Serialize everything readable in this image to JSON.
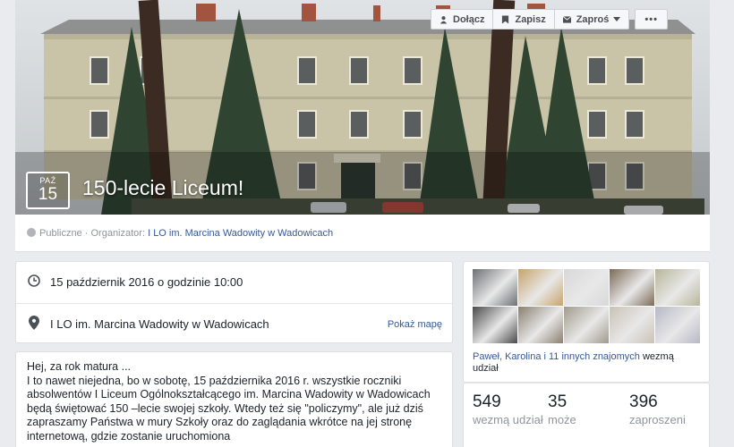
{
  "event": {
    "month": "PAŹ",
    "day": "15",
    "title": "150-lecie Liceum!"
  },
  "infobar": {
    "privacy": "Publiczne",
    "organizer_prefix": "· Organizator:",
    "organizer_name": "I LO im. Marcina Wadowity w Wadowicach"
  },
  "actions": {
    "join": "Dołącz",
    "save": "Zapisz",
    "invite": "Zaproś",
    "more": "•••"
  },
  "details": {
    "datetime": "15 październik 2016 o godzinie 10:00",
    "location": "I LO im. Marcina Wadowity w Wadowicach",
    "map_link": "Pokaż mapę"
  },
  "description": {
    "line1": "Hej, za rok matura ...",
    "body": "I to nawet niejedna, bo w sobotę, 15 października 2016 r. wszystkie roczniki absolwentów I Liceum Ogólnokształcącego im. Marcina Wadowity w Wadowicach będą świętować 150 –lecie swojej szkoły. Wtedy też się \"policzymy\", ale już dziś zapraszamy Państwa w mury Szkoły oraz do zaglądania wkrótce na jej stronę internetową, gdzie zostanie uruchomiona"
  },
  "friends": {
    "names": "Paweł, Karolina i 11 innych znajomych",
    "suffix": "wezmą udział",
    "avatar_colors": [
      "#6d6f73",
      "#c8a36a",
      "#d8d8d8",
      "#7c6a57",
      "#b8b59a",
      "#4a4a4a",
      "#8a7f6f",
      "#a09a8c",
      "#c9c1b5",
      "#b7b7c7"
    ]
  },
  "stats": [
    {
      "num": "549",
      "label": "wezmą udział"
    },
    {
      "num": "35",
      "label": "może"
    },
    {
      "num": "396",
      "label": "zaproszeni"
    }
  ],
  "colors": {
    "link": "#365899",
    "muted": "#90949c",
    "background": "#e9ebee"
  }
}
